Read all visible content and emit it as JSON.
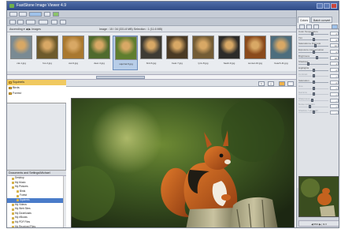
{
  "window": {
    "title": "FastStone Image Viewer 4.9"
  },
  "menu": {
    "items": [
      "File",
      "Edit",
      "View",
      "Tools",
      "Help"
    ]
  },
  "pathbar": {
    "left": "Ascending  ▾  ◀ ▶  Images",
    "mid": "Image : 15 / 34 (331.8 MB)  Selection : 1 (11.6 MB)"
  },
  "thumbnails": [
    {
      "caption": "cat-1.jpg",
      "bg": "#7a8a93"
    },
    {
      "caption": "fox-2.jpg",
      "bg": "#6d5a2c"
    },
    {
      "caption": "owl-3.jpg",
      "bg": "#a9782f"
    },
    {
      "caption": "deer-4.jpg",
      "bg": "#4f6a2d"
    },
    {
      "caption": "squirrel-5.jpg",
      "bg": "#5f7e2e",
      "selected": true
    },
    {
      "caption": "bird-6.jpg",
      "bg": "#3d3b34"
    },
    {
      "caption": "bear-7.jpg",
      "bg": "#4a3a24"
    },
    {
      "caption": "lynx-8.jpg",
      "bg": "#735c35"
    },
    {
      "caption": "hawk-9.jpg",
      "bg": "#2c2b29"
    },
    {
      "caption": "sunset-10.jpg",
      "bg": "#8a4a1c"
    },
    {
      "caption": "beach-11.jpg",
      "bg": "#4d6d7d"
    }
  ],
  "folders": [
    {
      "label": "Squirrels",
      "active": true
    },
    {
      "label": "Birds"
    },
    {
      "label": "Forest"
    }
  ],
  "tree": {
    "header": "Documents and Settings\\Michael",
    "items": [
      {
        "label": "Desktop",
        "indent": 1
      },
      {
        "label": "My Music",
        "indent": 1
      },
      {
        "label": "My Pictures",
        "indent": 1
      },
      {
        "label": "Birds",
        "indent": 2
      },
      {
        "label": "Forest",
        "indent": 2
      },
      {
        "label": "Squirrels",
        "indent": 2,
        "selected": true
      },
      {
        "label": "My Videos",
        "indent": 1
      },
      {
        "label": "My Web Sites",
        "indent": 1
      },
      {
        "label": "My Downloads",
        "indent": 1
      },
      {
        "label": "My eBooks",
        "indent": 1
      },
      {
        "label": "My PDF Files",
        "indent": 1
      },
      {
        "label": "My Received Files",
        "indent": 1
      }
    ]
  },
  "mainhead": {
    "buttons": [
      "1",
      "+"
    ]
  },
  "rightpanel": {
    "tabs": [
      "Colors",
      "Batch convert"
    ],
    "adjustments": [
      {
        "label": "Color Temperature",
        "value": "0",
        "knob": 0.45
      },
      {
        "label": "Tint",
        "value": "0",
        "knob": 0.5
      },
      {
        "label": "Saturation   ▸ Flat look",
        "value": "10",
        "knob": 0.55
      },
      {
        "label": "Exposure compensation",
        "value": "0",
        "knob": 0.5
      },
      {
        "label": "Brightness",
        "value": "18",
        "knob": 0.6
      },
      {
        "label": "Shadows",
        "value": "4",
        "knob": 0.3
      },
      {
        "label": "Highlights",
        "value": "-3",
        "knob": 0.5
      },
      {
        "label": "Contrast",
        "value": "0",
        "knob": 0.5,
        "dim": true
      },
      {
        "label": "Saturation",
        "value": "0",
        "knob": 0.5
      },
      {
        "label": "Hue",
        "value": "0",
        "knob": 0.5,
        "dim": true
      },
      {
        "label": "Gamma",
        "value": "0",
        "knob": 0.5,
        "dim": true
      },
      {
        "label": "Sharpness",
        "value": "0",
        "knob": 0.45,
        "dim": true
      },
      {
        "label": "Noise reduction",
        "value": "0",
        "knob": 0.35,
        "dim": true
      },
      {
        "label": "Shadow / Highlight",
        "value": "0",
        "knob": 0.5,
        "dim": true
      }
    ],
    "zoom": "◀  55%  ▶   |  fit  ▾"
  }
}
